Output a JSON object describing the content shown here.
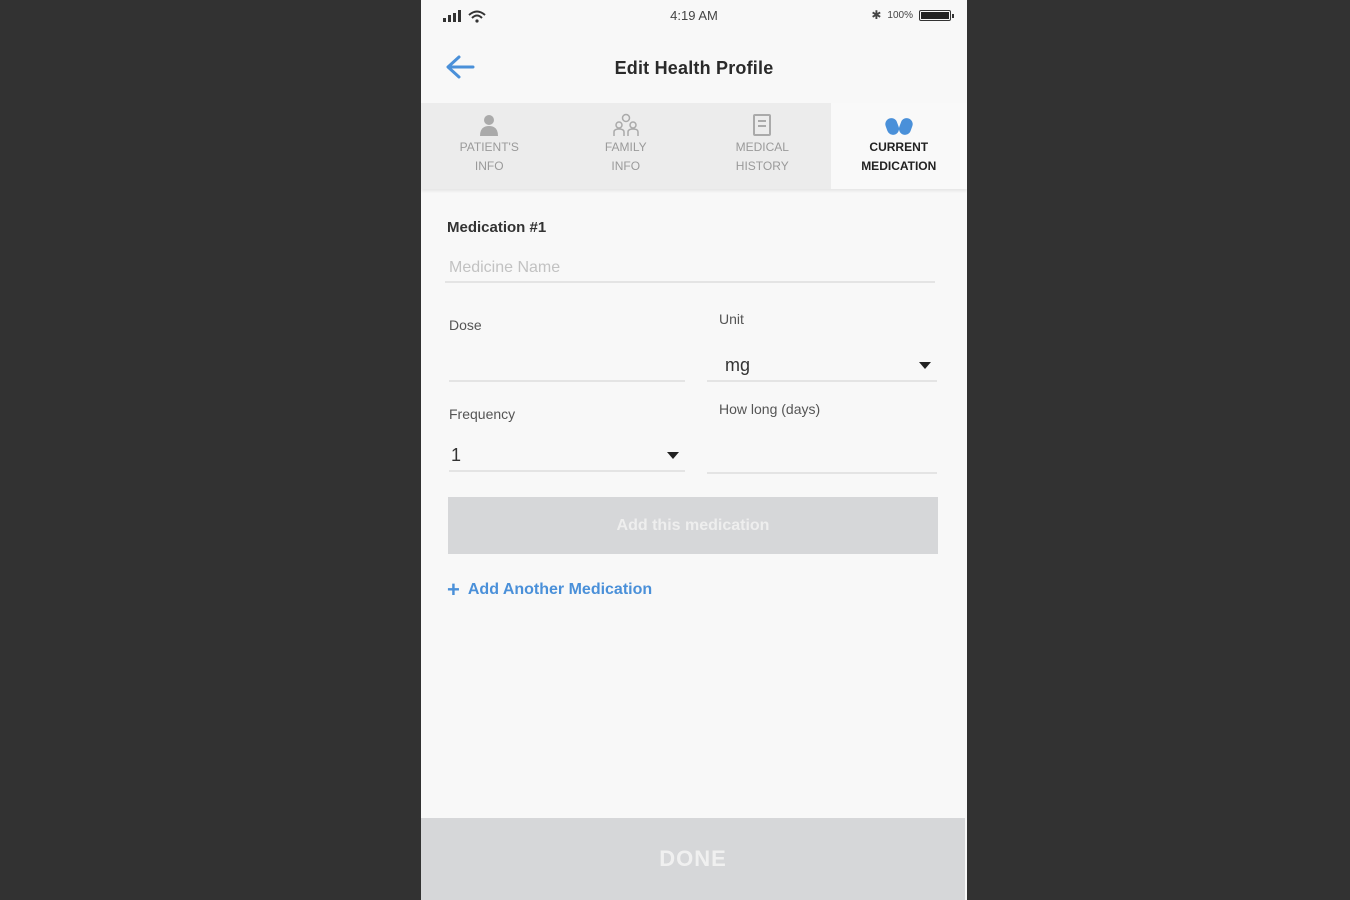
{
  "status_bar": {
    "time": "4:19 AM",
    "battery_text": "100%"
  },
  "header": {
    "title": "Edit Health Profile"
  },
  "tabs": [
    {
      "label": "PATIENT'S\nINFO",
      "icon": "person-icon",
      "active": false
    },
    {
      "label": "FAMILY\nINFO",
      "icon": "family-icon",
      "active": false
    },
    {
      "label": "MEDICAL\nHISTORY",
      "icon": "book-icon",
      "active": false
    },
    {
      "label": "CURRENT\nMEDICATION",
      "icon": "pills-icon",
      "active": true
    }
  ],
  "form": {
    "section_title": "Medication #1",
    "medicine_name_placeholder": "Medicine Name",
    "dose_label": "Dose",
    "dose_value": "",
    "unit_label": "Unit",
    "unit_value": "mg",
    "frequency_label": "Frequency",
    "frequency_value": "1",
    "how_long_label": "How long (days)",
    "how_long_value": "",
    "add_button": "Add this medication",
    "add_another": "Add Another Medication"
  },
  "footer": {
    "done_button": "DONE"
  },
  "colors": {
    "accent": "#4a90d9",
    "disabled_button": "#d6d7d9",
    "background_outer": "#323232"
  }
}
